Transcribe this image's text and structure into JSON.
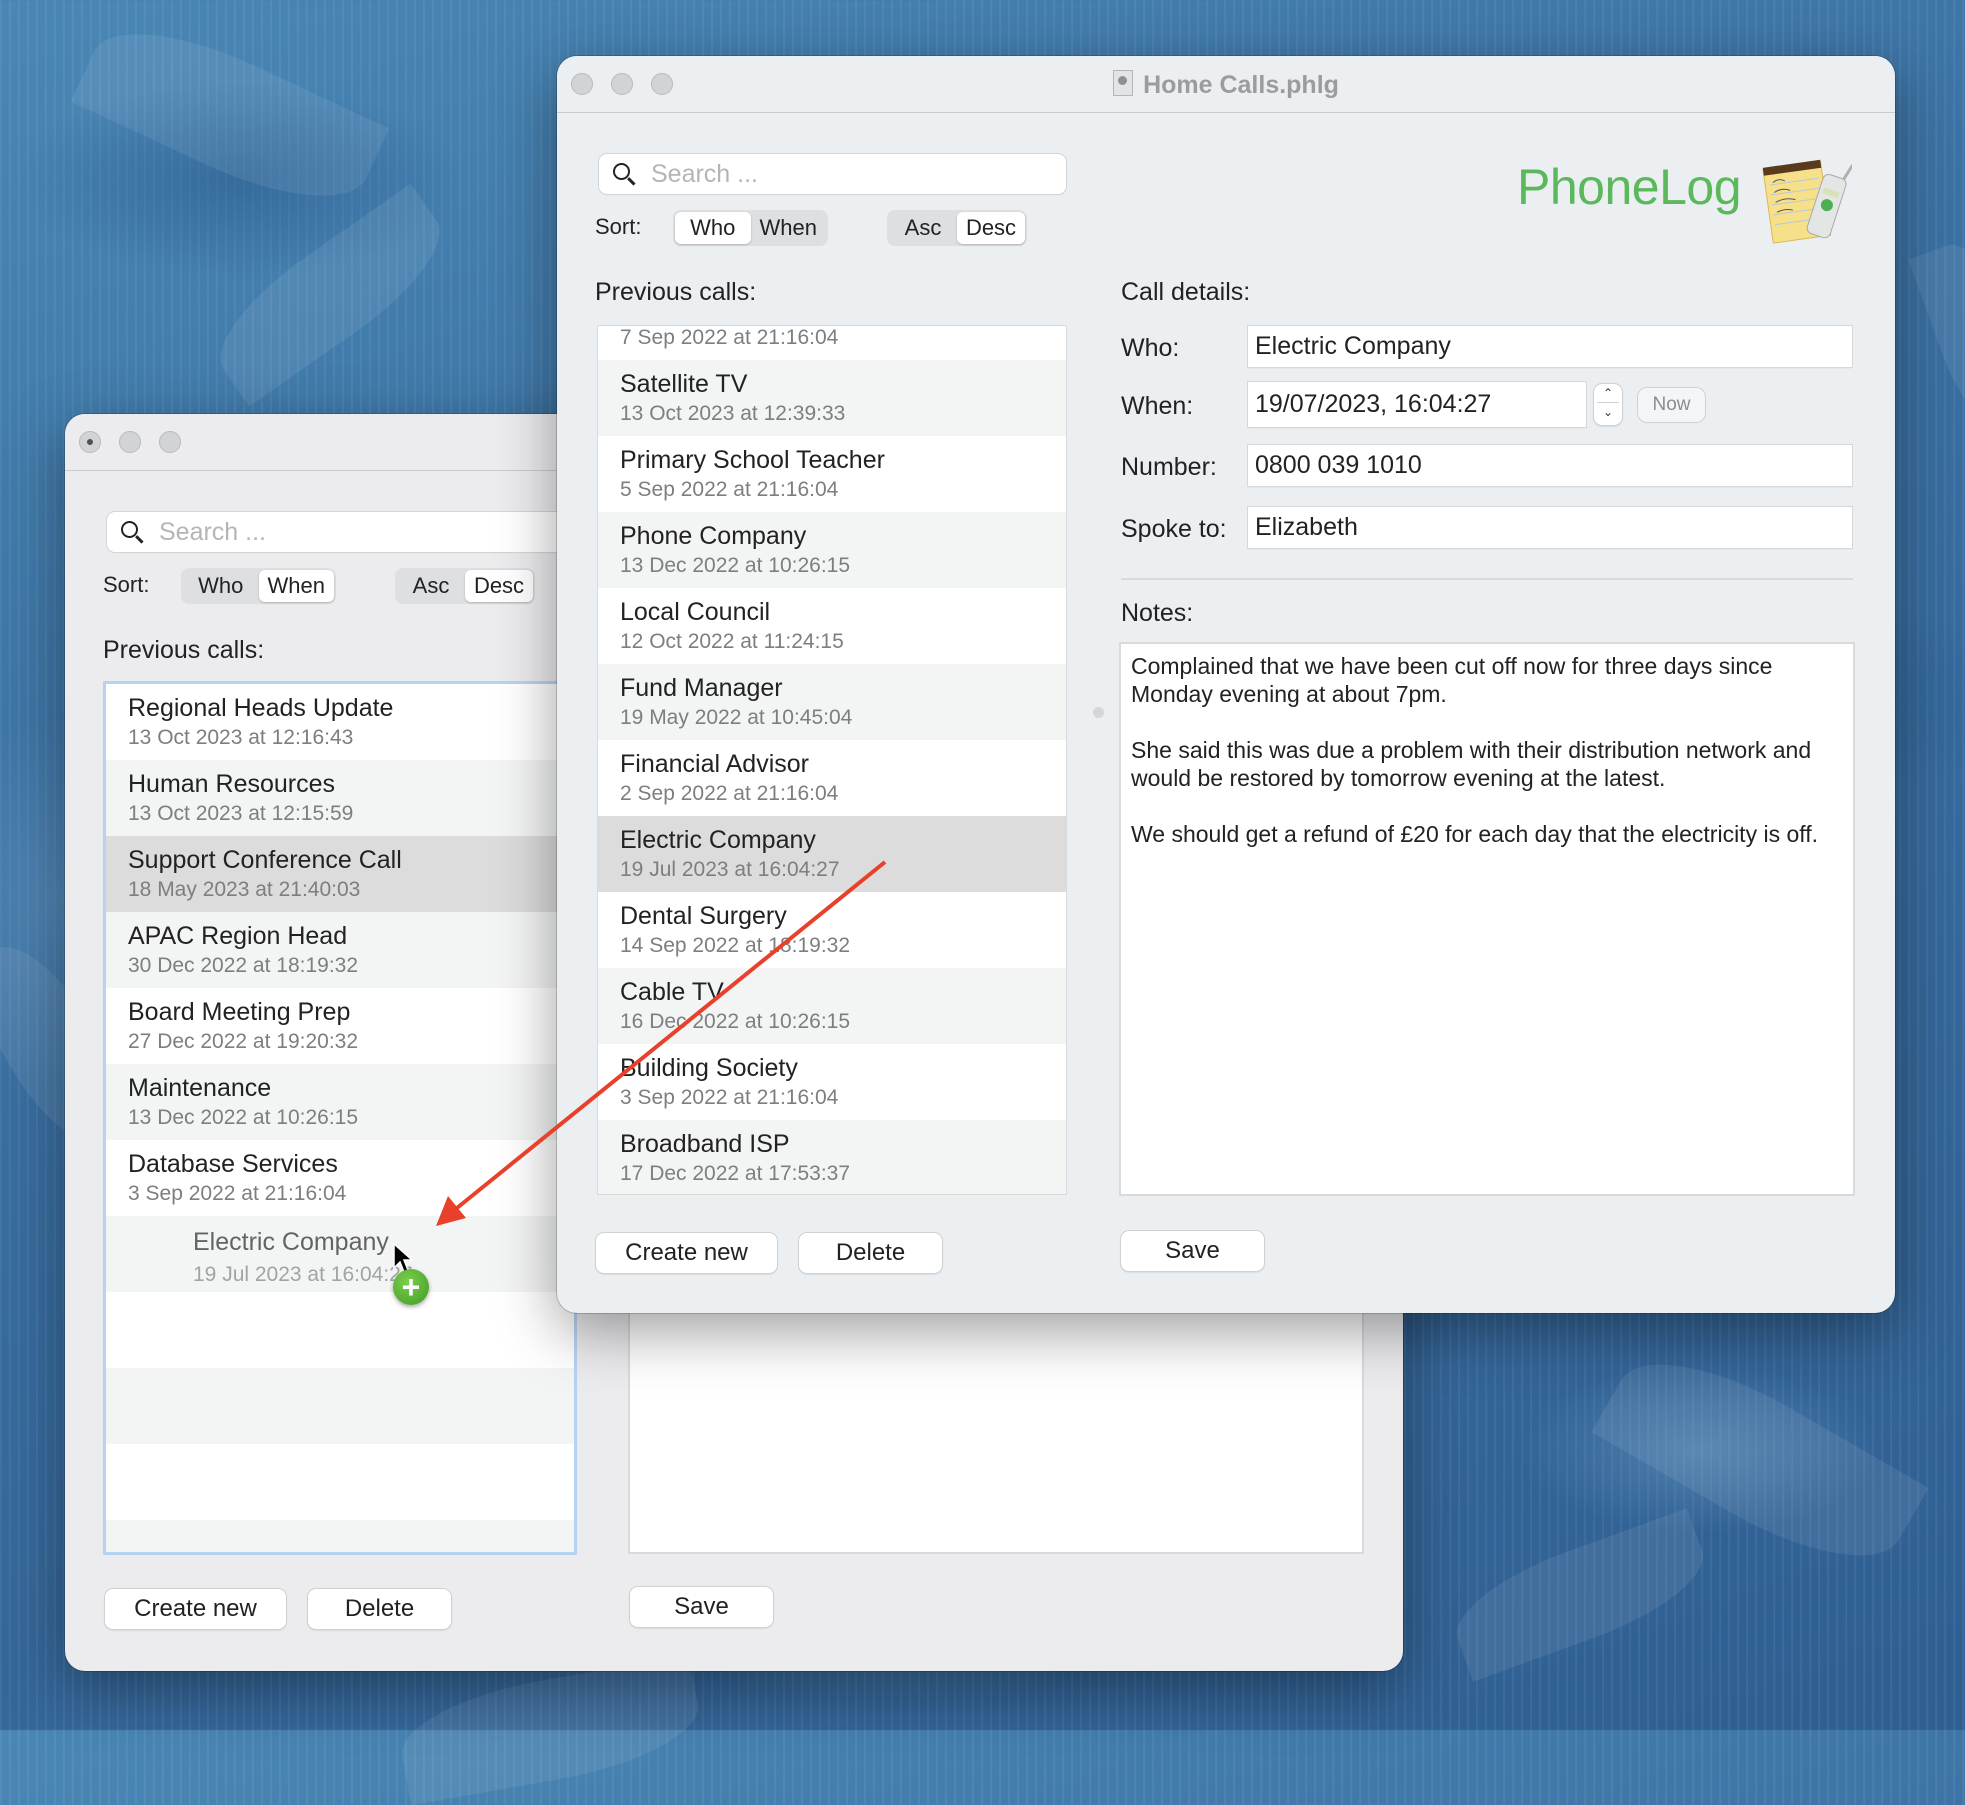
{
  "back_window": {
    "title": "",
    "search": {
      "placeholder": "Search ...",
      "value": ""
    },
    "sort": {
      "label": "Sort:",
      "field_options": [
        "Who",
        "When"
      ],
      "field_selected": "When",
      "order_options": [
        "Asc",
        "Desc"
      ],
      "order_selected": "Desc"
    },
    "previous_calls_label": "Previous calls:",
    "calls": [
      {
        "who": "Regional Heads Update",
        "when": "13 Oct 2023 at 12:16:43"
      },
      {
        "who": "Human Resources",
        "when": "13 Oct 2023 at 12:15:59"
      },
      {
        "who": "Support Conference Call",
        "when": "18 May 2023 at 21:40:03",
        "selected": true
      },
      {
        "who": "APAC Region Head",
        "when": "30 Dec 2022 at 18:19:32"
      },
      {
        "who": "Board Meeting Prep",
        "when": "27 Dec 2022 at 19:20:32"
      },
      {
        "who": "Maintenance",
        "when": "13 Dec 2022 at 10:26:15"
      },
      {
        "who": "Database Services",
        "when": "3 Sep 2022 at 21:16:04"
      }
    ],
    "buttons": {
      "create_new": "Create new",
      "delete": "Delete",
      "save": "Save"
    },
    "drag_item": {
      "who": "Electric Company",
      "when": "19 Jul 2023 at 16:04:27"
    }
  },
  "front_window": {
    "title": "Home Calls.phlg",
    "brand": "PhoneLog",
    "search": {
      "placeholder": "Search ...",
      "value": ""
    },
    "sort": {
      "label": "Sort:",
      "field_options": [
        "Who",
        "When"
      ],
      "field_selected": "Who",
      "order_options": [
        "Asc",
        "Desc"
      ],
      "order_selected": "Desc"
    },
    "previous_calls_label": "Previous calls:",
    "calls": [
      {
        "who": "",
        "when": "7 Sep 2022 at 21:16:04"
      },
      {
        "who": "Satellite TV",
        "when": "13 Oct 2023 at 12:39:33"
      },
      {
        "who": "Primary School Teacher",
        "when": "5 Sep 2022 at 21:16:04"
      },
      {
        "who": "Phone Company",
        "when": "13 Dec 2022 at 10:26:15"
      },
      {
        "who": "Local Council",
        "when": "12 Oct 2022 at 11:24:15"
      },
      {
        "who": "Fund Manager",
        "when": "19 May 2022 at 10:45:04"
      },
      {
        "who": "Financial Advisor",
        "when": "2 Sep 2022 at 21:16:04"
      },
      {
        "who": "Electric Company",
        "when": "19 Jul 2023 at 16:04:27",
        "selected": true
      },
      {
        "who": "Dental Surgery",
        "when": "14 Sep 2022 at 18:19:32"
      },
      {
        "who": "Cable TV",
        "when": "16 Dec 2022 at 10:26:15"
      },
      {
        "who": "Building Society",
        "when": "3 Sep 2022 at 21:16:04"
      },
      {
        "who": "Broadband ISP",
        "when": "17 Dec 2022 at 17:53:37"
      }
    ],
    "details": {
      "heading": "Call details:",
      "who_label": "Who:",
      "who_value": "Electric Company",
      "when_label": "When:",
      "when_value": "19/07/2023, 16:04:27",
      "now_button": "Now",
      "number_label": "Number:",
      "number_value": "0800 039 1010",
      "spoke_to_label": "Spoke to:",
      "spoke_to_value": "Elizabeth",
      "notes_label": "Notes:",
      "notes_value": "Complained that we have been cut off now for three days since Monday evening at about 7pm.\n\nShe said this was due a problem with their distribution network and would be restored by tomorrow evening at the latest.\n\nWe should get a refund of £20 for each day that the electricity is off."
    },
    "buttons": {
      "create_new": "Create new",
      "delete": "Delete",
      "save": "Save"
    }
  },
  "colors": {
    "brand_green": "#5cb85c",
    "annotation_arrow": "#e8402a",
    "drag_plus": "#4caf30"
  }
}
